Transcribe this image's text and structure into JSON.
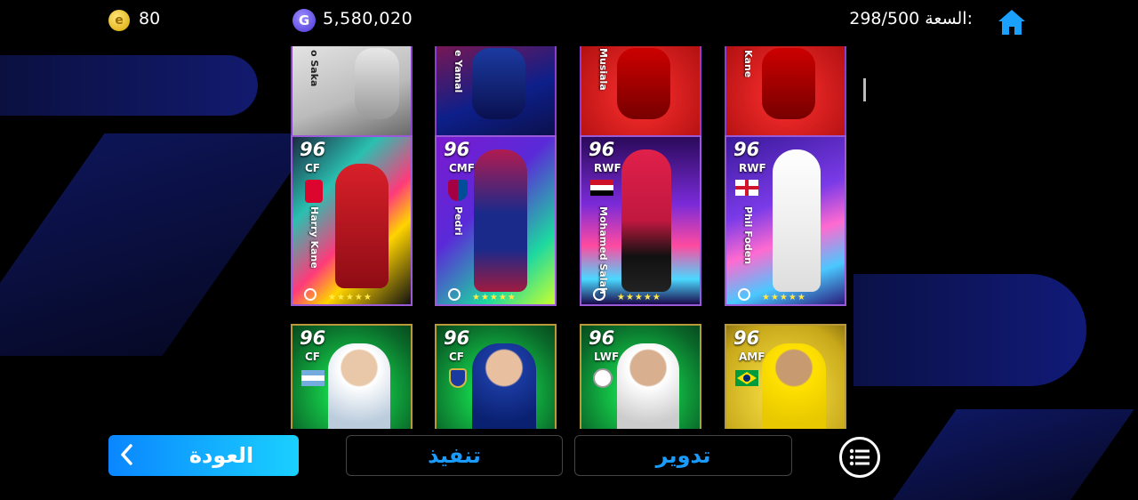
{
  "header": {
    "coins": "80",
    "gp": "5,580,020",
    "capacity_label": "السعة:",
    "capacity_value": "298/500"
  },
  "icons": [
    "coin-icon",
    "gp-icon",
    "home-icon",
    "menu-list-icon",
    "chevron-left-icon"
  ],
  "colors": {
    "accent": "#1a9cff",
    "button_gradient_start": "#0a86ff",
    "button_gradient_end": "#1ad0ff",
    "stars": "#ffe94a"
  },
  "cards_partial_row": [
    {
      "name": "o Saka"
    },
    {
      "name": "e Yamal"
    },
    {
      "name": "Musiala"
    },
    {
      "name": "Kane"
    }
  ],
  "cards_row_2": [
    {
      "rating": "96",
      "position": "CF",
      "name": "Harry Kane"
    },
    {
      "rating": "96",
      "position": "CMF",
      "name": "Pedri"
    },
    {
      "rating": "96",
      "position": "RWF",
      "name": "Mohamed Salah"
    },
    {
      "rating": "96",
      "position": "RWF",
      "name": "Phil Foden"
    }
  ],
  "cards_row_3": [
    {
      "rating": "96",
      "position": "CF"
    },
    {
      "rating": "96",
      "position": "CF"
    },
    {
      "rating": "96",
      "position": "LWF"
    },
    {
      "rating": "96",
      "position": "AMF"
    }
  ],
  "stars": "★★★★★",
  "buttons": {
    "back": "العودة",
    "execute": "تنفيذ",
    "roll": "تدوير"
  }
}
